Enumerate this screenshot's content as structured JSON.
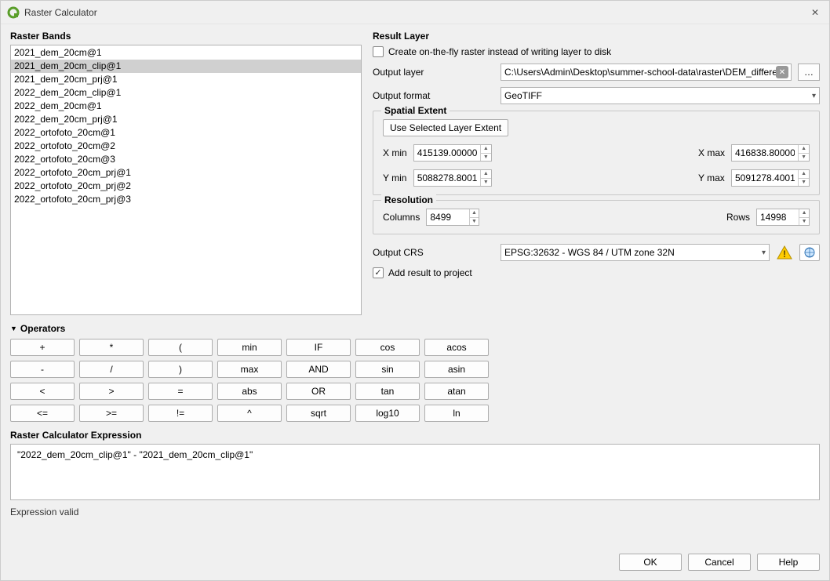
{
  "window": {
    "title": "Raster Calculator"
  },
  "raster_bands": {
    "label": "Raster Bands",
    "items": [
      "2021_dem_20cm@1",
      "2021_dem_20cm_clip@1",
      "2021_dem_20cm_prj@1",
      "2022_dem_20cm_clip@1",
      "2022_dem_20cm@1",
      "2022_dem_20cm_prj@1",
      "2022_ortofoto_20cm@1",
      "2022_ortofoto_20cm@2",
      "2022_ortofoto_20cm@3",
      "2022_ortofoto_20cm_prj@1",
      "2022_ortofoto_20cm_prj@2",
      "2022_ortofoto_20cm_prj@3"
    ],
    "selected_index": 1
  },
  "result_layer": {
    "label": "Result Layer",
    "create_onfly": {
      "label": "Create on-the-fly raster instead of writing layer to disk",
      "checked": false
    },
    "output_layer": {
      "label": "Output layer",
      "value": "C:\\Users\\Admin\\Desktop\\summer-school-data\\raster\\DEM_differences"
    },
    "browse_label": "…",
    "output_format": {
      "label": "Output format",
      "value": "GeoTIFF"
    },
    "spatial_extent": {
      "label": "Spatial Extent",
      "use_selected_btn": "Use Selected Layer Extent",
      "xmin": {
        "label": "X min",
        "value": "415139.00000"
      },
      "xmax": {
        "label": "X max",
        "value": "416838.80000"
      },
      "ymin": {
        "label": "Y min",
        "value": "5088278.80012"
      },
      "ymax": {
        "label": "Y max",
        "value": "5091278.40012"
      }
    },
    "resolution": {
      "label": "Resolution",
      "columns": {
        "label": "Columns",
        "value": "8499"
      },
      "rows": {
        "label": "Rows",
        "value": "14998"
      }
    },
    "output_crs": {
      "label": "Output CRS",
      "value": "EPSG:32632 - WGS 84 / UTM zone 32N"
    },
    "add_result": {
      "label": "Add result to project",
      "checked": true
    }
  },
  "operators": {
    "label": "Operators",
    "rows": [
      [
        "+",
        "*",
        "(",
        "min",
        "IF",
        "cos",
        "acos"
      ],
      [
        "-",
        "/",
        ")",
        "max",
        "AND",
        "sin",
        "asin"
      ],
      [
        "<",
        ">",
        "=",
        "abs",
        "OR",
        "tan",
        "atan"
      ],
      [
        "<=",
        ">=",
        "!=",
        "^",
        "sqrt",
        "log10",
        "ln"
      ]
    ]
  },
  "expression": {
    "label": "Raster Calculator Expression",
    "value": "\"2022_dem_20cm_clip@1\" - \"2021_dem_20cm_clip@1\"",
    "validity": "Expression valid"
  },
  "footer": {
    "ok": "OK",
    "cancel": "Cancel",
    "help": "Help"
  }
}
